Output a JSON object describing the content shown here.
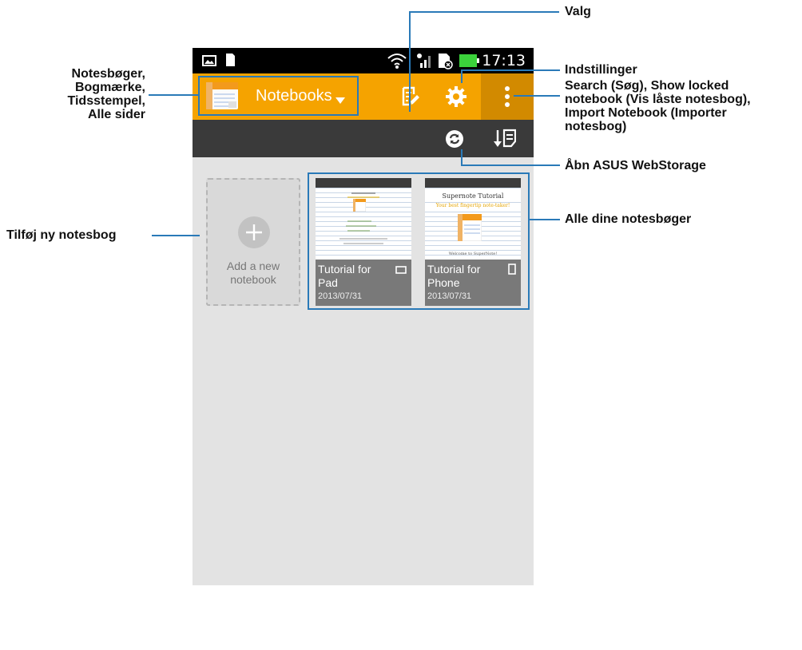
{
  "status_bar": {
    "time": "17:13"
  },
  "action_bar": {
    "notebooks_label": "Notebooks"
  },
  "notebooks": {
    "add_new_label": "Add a new\nnotebook",
    "items": [
      {
        "title": "Tutorial for\nPad",
        "date": "2013/07/31",
        "device": "tablet-icon"
      },
      {
        "title": "Tutorial for\nPhone",
        "date": "2013/07/31",
        "device": "phone-icon"
      }
    ],
    "thumb_phone_heading": "Supernote Tutorial",
    "thumb_phone_subheading": "Your best fingertip note-taker!",
    "thumb_phone_footer": "Welcome to SuperNote!"
  },
  "callouts": {
    "valg": "Valg",
    "indstillinger": "Indstillinger",
    "menu_options": "Search (Søg), Show locked\nnotebook (Vis låste notesbog),\nImport Notebook (Importer\nnotesbog)",
    "webstorage": "Åbn ASUS WebStorage",
    "all_notebooks": "Alle dine notesbøger",
    "left_menu": "Notesbøger,\nBogmærke,\nTidsstempel,\nAlle sider",
    "add_notebook": "Tilføj ny notesbog"
  },
  "colors": {
    "action_bar": "#f5a300",
    "callout_line": "#2a7ab8",
    "sub_bar": "#3a3a3a",
    "background": "#e3e3e3"
  }
}
